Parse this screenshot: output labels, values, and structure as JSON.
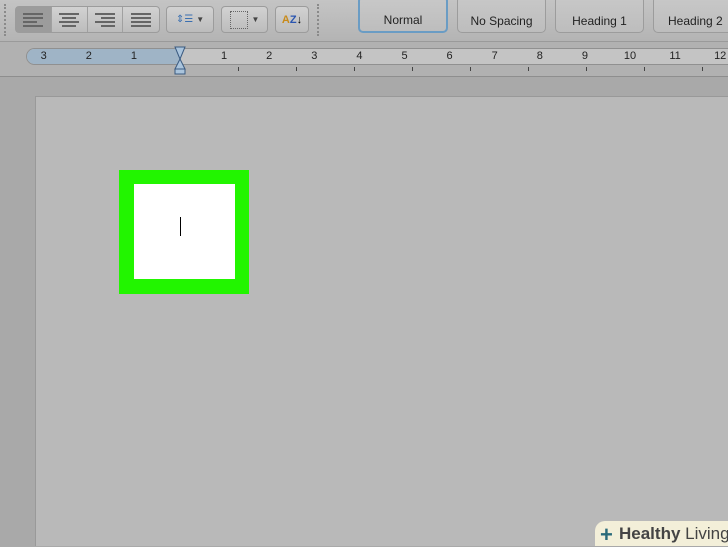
{
  "styles": [
    "Normal",
    "No Spacing",
    "Heading 1",
    "Heading 2"
  ],
  "ruler": {
    "left": [
      "3",
      "2",
      "1"
    ],
    "right": [
      "1",
      "2",
      "3",
      "4",
      "5",
      "6",
      "7",
      "8",
      "9",
      "10",
      "11",
      "12"
    ]
  },
  "watermark": {
    "bold": "Healthy",
    "rest": " Living"
  },
  "colors": {
    "highlight": "#22f500"
  }
}
